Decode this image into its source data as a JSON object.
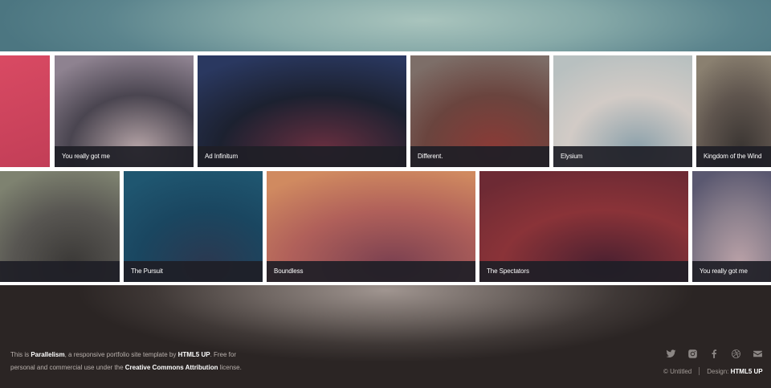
{
  "row1": [
    {
      "caption": "",
      "colors": [
        "#d94a63",
        "#c23e57"
      ]
    },
    {
      "caption": "You really got me",
      "colors": [
        "#8e8290",
        "#4a4550",
        "#b7a5a8"
      ]
    },
    {
      "caption": "Ad Infinitum",
      "colors": [
        "#2a3860",
        "#1c2130",
        "#6a2f40"
      ]
    },
    {
      "caption": "Different.",
      "colors": [
        "#7d6e68",
        "#6a443e",
        "#8b3a36"
      ]
    },
    {
      "caption": "Elysium",
      "colors": [
        "#b8c0c0",
        "#d2cbc6",
        "#8aa0aa"
      ]
    },
    {
      "caption": "Kingdom of the Wind",
      "colors": [
        "#8a8070",
        "#5f554e",
        "#3a3532"
      ]
    }
  ],
  "row2": [
    {
      "caption": "",
      "colors": [
        "#7e8270",
        "#585652",
        "#3a3836"
      ]
    },
    {
      "caption": "The Pursuit",
      "colors": [
        "#1f5670",
        "#1a4660",
        "#2b3850"
      ]
    },
    {
      "caption": "Boundless",
      "colors": [
        "#d08a60",
        "#b0605a",
        "#7a4050"
      ]
    },
    {
      "caption": "The Spectators",
      "colors": [
        "#6d2a34",
        "#8a3338",
        "#4a2030"
      ]
    },
    {
      "caption": "You really got me",
      "colors": [
        "#5a5870",
        "#8a7f8c",
        "#bba2a8"
      ]
    }
  ],
  "footer": {
    "line1_pre": "This is ",
    "brand": "Parallelism",
    "line1_mid": ", a responsive portfolio site template by ",
    "author": "HTML5 UP",
    "line1_post": ". Free for",
    "line2_pre": "personal and commercial use under the ",
    "license": "Creative Commons Attribution",
    "line2_post": " license.",
    "copyright": "© Untitled",
    "design_label": "Design: ",
    "design_author": "HTML5 UP"
  },
  "socials": [
    "twitter-icon",
    "instagram-icon",
    "facebook-icon",
    "dribbble-icon",
    "email-icon"
  ]
}
